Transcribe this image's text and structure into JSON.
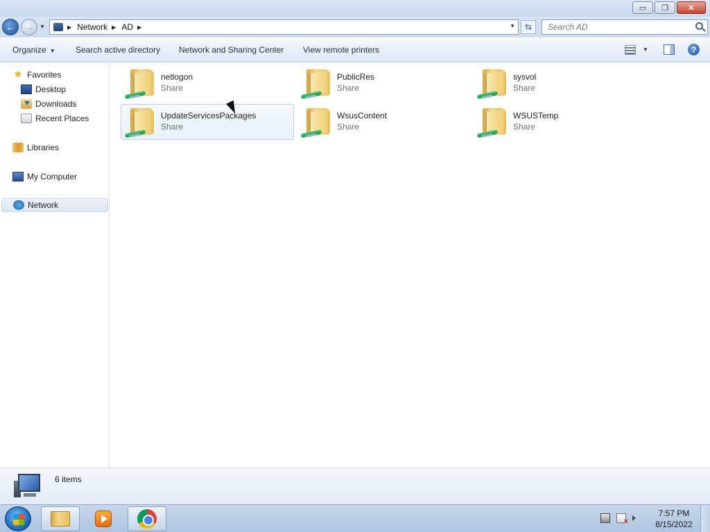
{
  "window": {
    "controls": {
      "minimize": "▭",
      "maximize": "❐",
      "close": "✕"
    }
  },
  "address": {
    "crumbs": [
      "Network",
      "AD"
    ],
    "search_placeholder": "Search AD"
  },
  "toolbar": {
    "organize": "Organize",
    "search_ad": "Search active directory",
    "network_sharing": "Network and Sharing Center",
    "view_printers": "View remote printers",
    "help": "?"
  },
  "nav": {
    "favorites": "Favorites",
    "desktop": "Desktop",
    "downloads": "Downloads",
    "recent": "Recent Places",
    "libraries": "Libraries",
    "computer": "My Computer",
    "network": "Network"
  },
  "items": [
    {
      "name": "netlogon",
      "type": "Share"
    },
    {
      "name": "PublicRes",
      "type": "Share"
    },
    {
      "name": "sysvol",
      "type": "Share"
    },
    {
      "name": "UpdateServicesPackages",
      "type": "Share"
    },
    {
      "name": "WsusContent",
      "type": "Share"
    },
    {
      "name": "WSUSTemp",
      "type": "Share"
    }
  ],
  "status": {
    "count": "6 items"
  },
  "taskbar": {
    "time": "7:57 PM",
    "date": "8/15/2022"
  },
  "colors": {
    "accent": "#1e4f9a",
    "hover": "#e9f1fb"
  }
}
